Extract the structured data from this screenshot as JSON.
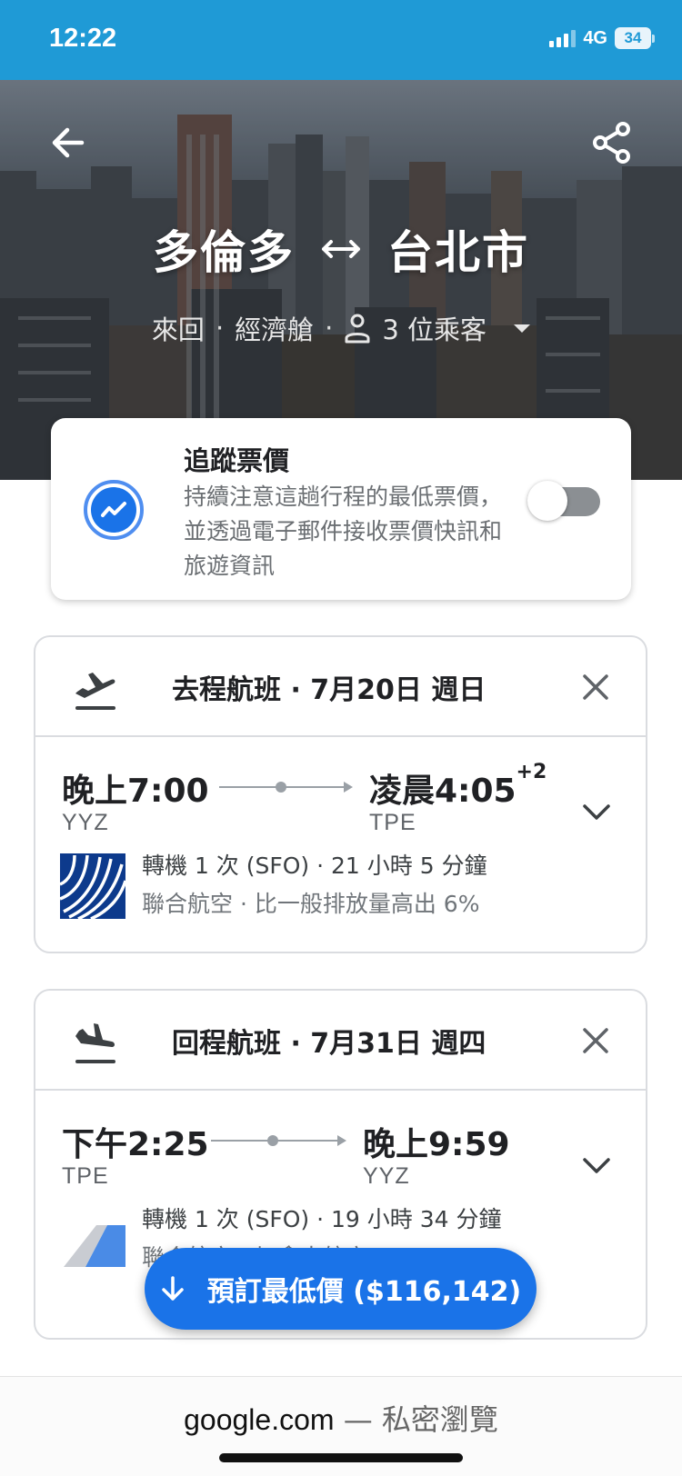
{
  "status_bar": {
    "time": "12:22",
    "network": "4G",
    "battery": "34"
  },
  "hero": {
    "origin": "多倫多",
    "destination": "台北市",
    "trip_type": "來回",
    "cabin": "經濟艙",
    "passengers": "3 位乘客",
    "separator": "·"
  },
  "tracking": {
    "title": "追蹤票價",
    "description": "持續注意這趟行程的最低票價，並透過電子郵件接收票價快訊和旅遊資訊",
    "enabled": false
  },
  "outbound": {
    "header": "去程航班 · 7月20日 週日",
    "depart_time": "晚上7:00",
    "arrive_time": "凌晨4:05",
    "day_offset": "+2",
    "from_code": "YYZ",
    "to_code": "TPE",
    "detail_1": "轉機 1 次 (SFO) · 21 小時 5 分鐘",
    "detail_2": "聯合航空 · 比一般排放量高出 6%"
  },
  "return": {
    "header": "回程航班 · 7月31日 週四",
    "depart_time": "下午2:25",
    "arrive_time": "晚上9:59",
    "from_code": "TPE",
    "to_code": "YYZ",
    "detail_1": "轉機 1 次 (SFO) · 19 小時 34 分鐘",
    "detail_2": "聯合航空 · 加拿大航空 ·"
  },
  "book_button": {
    "label": "預訂最低價 ($116,142)"
  },
  "browser": {
    "host": "google.com",
    "mode": " — 私密瀏覽"
  },
  "icons": {
    "back": "arrow-left-icon",
    "share": "share-icon",
    "swap": "swap-arrows-icon",
    "person": "person-icon",
    "trend": "trend-icon",
    "takeoff": "flight-takeoff-icon",
    "landing": "flight-land-icon",
    "close": "close-icon",
    "expand": "chevron-down-icon",
    "download": "arrow-down-icon"
  },
  "colors": {
    "status_bar": "#1f9ad6",
    "accent": "#1a73e8",
    "toggle_off": "#8b8f93",
    "text_secondary": "#5f6368"
  }
}
